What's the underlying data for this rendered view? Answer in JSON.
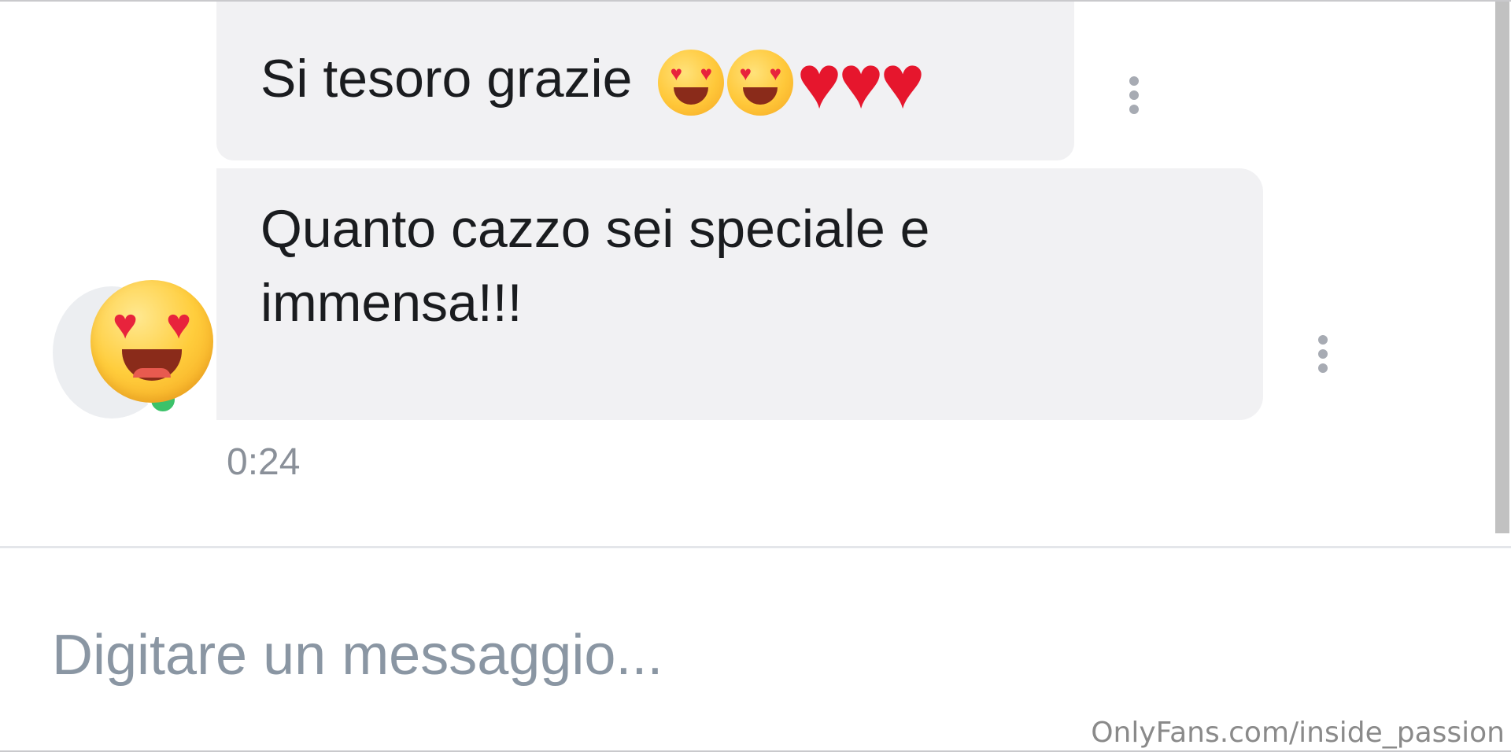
{
  "conversation": {
    "messages": [
      {
        "text": "Si tesoro grazie",
        "emojis": [
          "heart-eyes",
          "heart-eyes",
          "red-heart",
          "red-heart",
          "red-heart"
        ]
      },
      {
        "text": "Quanto cazzo sei speciale e immensa!!!"
      }
    ],
    "timestamp": "0:24"
  },
  "avatar": {
    "emoji": "heart-eyes",
    "status": "online",
    "status_color": "#3cc26a"
  },
  "composer": {
    "placeholder": "Digitare un messaggio..."
  },
  "watermark": "OnlyFans.com/inside_passion",
  "colors": {
    "bubble": "#f1f1f3",
    "placeholder": "#8a96a3",
    "heart": "#e6162d"
  }
}
